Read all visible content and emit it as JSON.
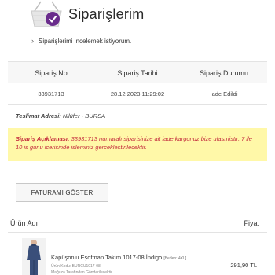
{
  "header": {
    "title": "Siparişlerim",
    "icon": "shopping-basket-check-icon",
    "accent_color": "#6a2c8c"
  },
  "info_link": {
    "label": "Siparişlerimi incelemek istiyorum."
  },
  "order_table": {
    "columns": [
      "Sipariş No",
      "Sipariş Tarihi",
      "Sipariş Durumu"
    ],
    "values": [
      "33931713",
      "28.12.2023 11:29:02",
      "Iade Edildi"
    ]
  },
  "shipping": {
    "label": "Teslimat Adresi:",
    "value": "Nilüfer - BURSA"
  },
  "notice": {
    "label": "Sipariş Açıklaması:",
    "text": "33931713 numaralı siparisinize ait iade kargonuz bize ulasmistir. 7 ile 10 is gunu icerisinde isleminiz gerceklestirilecektir.",
    "background": "#fff8a8",
    "text_color": "#c32a3c"
  },
  "invoice_button": {
    "label": "FATURAMI GÖSTER"
  },
  "products": {
    "headers": {
      "name": "Ürün Adı",
      "price": "Fiyat"
    },
    "items": [
      {
        "name": "Kapüşonlu Eşofman Takım 1017-08 İndigo",
        "size": "[Beden: 4XL]",
        "code": "Ürün Kodu: BURCU1017-08",
        "seller": "Mağaza Tarafından Gönderilecektir.",
        "price": "291,90 TL",
        "image": "indigo-tracksuit-photo"
      }
    ]
  }
}
